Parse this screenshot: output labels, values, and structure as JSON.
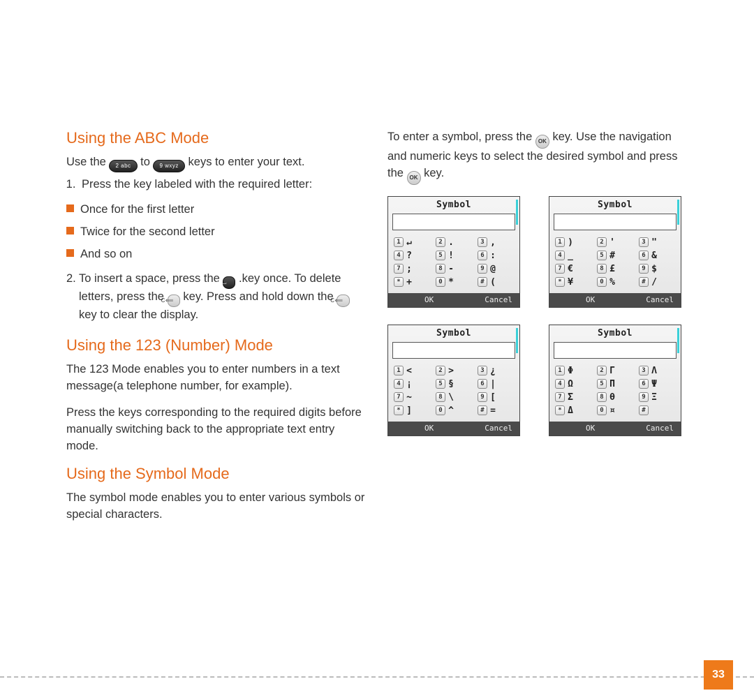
{
  "page_number": "33",
  "left": {
    "h1": "Using the ABC Mode",
    "p1a": "Use the ",
    "key2abc": "2 abc",
    "p1b": " to",
    "key9wxyz": "9 wxyz",
    "p1c": " keys to enter your text.",
    "step1": "Press the key labeled with the required letter:",
    "bullets": [
      "Once for the first letter",
      "Twice for the second letter",
      "And so on"
    ],
    "step2a": "2. To insert a space, press the ",
    "key0": "0 ⌴",
    "step2b": " .key once. To delete letters, press the",
    "keyC1": "C⟸",
    "step2c": " key. Press and hold down the",
    "keyC2": "C⟸",
    "step2d": " key to clear the display.",
    "h2": "Using the 123 (Number) Mode",
    "p2": "The 123 Mode enables you to enter numbers in a text message(a telephone number, for example).",
    "p3": "Press the keys corresponding to the required digits before manually switching back to the appropriate text entry mode.",
    "h3": "Using the Symbol Mode",
    "p4": "The symbol mode enables you to enter various symbols or special characters."
  },
  "right": {
    "p1a": "To enter a symbol, press the ",
    "keyOK1": "OK",
    "p1b": " key. Use the navigation and numeric keys to select the desired symbol and press the ",
    "keyOK2": "OK",
    "p1c": " key."
  },
  "screen_common": {
    "title": "Symbol",
    "ok": "OK",
    "cancel": "Cancel"
  },
  "screens": [
    {
      "cells": [
        {
          "n": "1",
          "s": "↵"
        },
        {
          "n": "2",
          "s": "."
        },
        {
          "n": "3",
          "s": ","
        },
        {
          "n": "4",
          "s": "?"
        },
        {
          "n": "5",
          "s": "!"
        },
        {
          "n": "6",
          "s": ":"
        },
        {
          "n": "7",
          "s": ";"
        },
        {
          "n": "8",
          "s": "-"
        },
        {
          "n": "9",
          "s": "@"
        },
        {
          "n": "*",
          "s": "+"
        },
        {
          "n": "0",
          "s": "*"
        },
        {
          "n": "#",
          "s": "("
        }
      ]
    },
    {
      "cells": [
        {
          "n": "1",
          "s": ")"
        },
        {
          "n": "2",
          "s": "'"
        },
        {
          "n": "3",
          "s": "\""
        },
        {
          "n": "4",
          "s": "_"
        },
        {
          "n": "5",
          "s": "#"
        },
        {
          "n": "6",
          "s": "&"
        },
        {
          "n": "7",
          "s": "€"
        },
        {
          "n": "8",
          "s": "£"
        },
        {
          "n": "9",
          "s": "$"
        },
        {
          "n": "*",
          "s": "¥"
        },
        {
          "n": "0",
          "s": "%"
        },
        {
          "n": "#",
          "s": "/"
        }
      ]
    },
    {
      "cells": [
        {
          "n": "1",
          "s": "<"
        },
        {
          "n": "2",
          "s": ">"
        },
        {
          "n": "3",
          "s": "¿"
        },
        {
          "n": "4",
          "s": "¡"
        },
        {
          "n": "5",
          "s": "§"
        },
        {
          "n": "6",
          "s": "|"
        },
        {
          "n": "7",
          "s": "~"
        },
        {
          "n": "8",
          "s": "\\"
        },
        {
          "n": "9",
          "s": "["
        },
        {
          "n": "*",
          "s": "]"
        },
        {
          "n": "0",
          "s": "^"
        },
        {
          "n": "#",
          "s": "="
        }
      ]
    },
    {
      "cells": [
        {
          "n": "1",
          "s": "Φ"
        },
        {
          "n": "2",
          "s": "Γ"
        },
        {
          "n": "3",
          "s": "Λ"
        },
        {
          "n": "4",
          "s": "Ω"
        },
        {
          "n": "5",
          "s": "Π"
        },
        {
          "n": "6",
          "s": "Ψ"
        },
        {
          "n": "7",
          "s": "Σ"
        },
        {
          "n": "8",
          "s": "θ"
        },
        {
          "n": "9",
          "s": "Ξ"
        },
        {
          "n": "*",
          "s": "Δ"
        },
        {
          "n": "0",
          "s": "¤"
        },
        {
          "n": "#",
          "s": ""
        }
      ]
    }
  ]
}
